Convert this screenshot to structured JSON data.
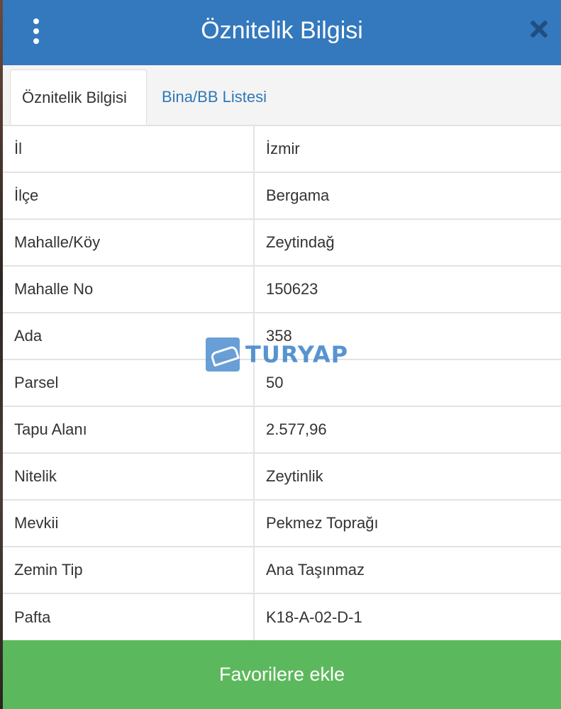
{
  "header": {
    "title": "Öznitelik Bilgisi",
    "menu_icon": "vertical-dots-icon",
    "close_icon": "close-icon"
  },
  "tabs": [
    {
      "label": "Öznitelik Bilgisi",
      "active": true
    },
    {
      "label": "Bina/BB Listesi",
      "active": false
    }
  ],
  "attributes": [
    {
      "key": "İl",
      "value": "İzmir"
    },
    {
      "key": "İlçe",
      "value": "Bergama"
    },
    {
      "key": "Mahalle/Köy",
      "value": "Zeytindağ"
    },
    {
      "key": "Mahalle No",
      "value": "150623"
    },
    {
      "key": "Ada",
      "value": "358"
    },
    {
      "key": "Parsel",
      "value": "50"
    },
    {
      "key": "Tapu Alanı",
      "value": "2.577,96"
    },
    {
      "key": "Nitelik",
      "value": "Zeytinlik"
    },
    {
      "key": "Mevkii",
      "value": "Pekmez Toprağı"
    },
    {
      "key": "Zemin Tip",
      "value": "Ana Taşınmaz"
    },
    {
      "key": "Pafta",
      "value": "K18-A-02-D-1"
    }
  ],
  "watermark": {
    "text": "TURYAP"
  },
  "footer": {
    "button_label": "Favorilere ekle"
  },
  "colors": {
    "header": "#3479bd",
    "tab_link": "#2f78b7",
    "footer_button": "#5cb85c"
  }
}
